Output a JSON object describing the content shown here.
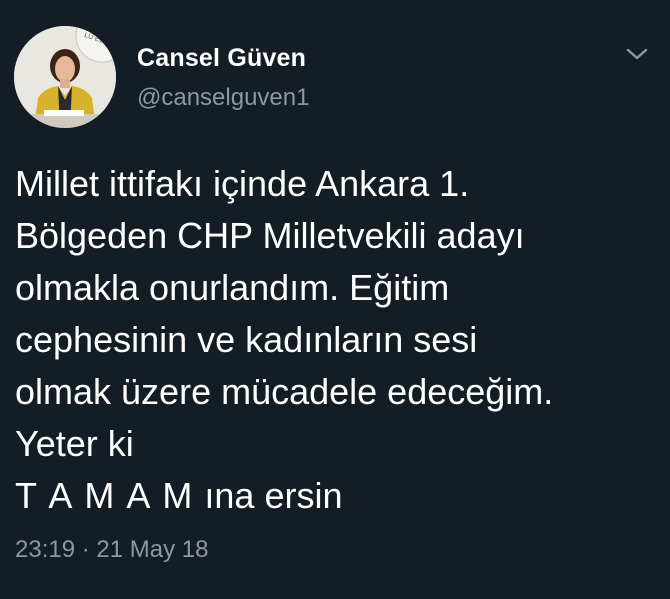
{
  "user": {
    "name": "Cansel Güven",
    "handle": "@canselguven1",
    "avatar_sign_text": "LU EGİTİ"
  },
  "tweet": {
    "lines": [
      "Millet ittifakı içinde Ankara 1.",
      "Bölgeden CHP Milletvekili adayı",
      "olmakla onurlandım. Eğitim",
      "cephesinin ve kadınların sesi",
      "olmak üzere mücadele edeceğim.",
      "Yeter ki"
    ],
    "last_line_spaced": "T A M A M",
    "last_line_rest": " ına ersin",
    "timestamp": "23:19 · 21 May 18"
  },
  "icons": {
    "menu": "chevron-down-icon"
  },
  "colors": {
    "background": "#141d26",
    "text": "#ffffff",
    "secondary": "#8899a6"
  }
}
